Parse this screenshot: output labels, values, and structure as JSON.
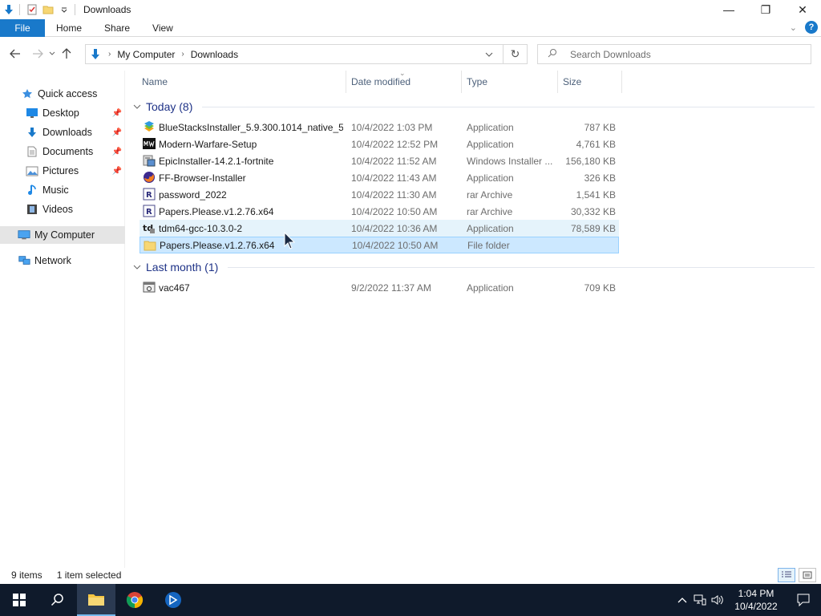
{
  "window": {
    "title": "Downloads",
    "controls": {
      "minimize": "—",
      "maximize": "❐",
      "close": "✕"
    }
  },
  "ribbon": {
    "tabs": [
      "File",
      "Home",
      "Share",
      "View"
    ]
  },
  "address": {
    "crumbs": [
      "My Computer",
      "Downloads"
    ]
  },
  "search": {
    "placeholder": "Search Downloads"
  },
  "nav": {
    "quick_access": "Quick access",
    "items": [
      {
        "label": "Desktop",
        "icon": "desktop-icon",
        "pinned": true
      },
      {
        "label": "Downloads",
        "icon": "downloads-icon",
        "pinned": true
      },
      {
        "label": "Documents",
        "icon": "documents-icon",
        "pinned": true
      },
      {
        "label": "Pictures",
        "icon": "pictures-icon",
        "pinned": true
      },
      {
        "label": "Music",
        "icon": "music-icon",
        "pinned": false
      },
      {
        "label": "Videos",
        "icon": "videos-icon",
        "pinned": false
      }
    ],
    "my_computer": "My Computer",
    "network": "Network"
  },
  "columns": {
    "name": "Name",
    "date": "Date modified",
    "type": "Type",
    "size": "Size"
  },
  "groups": [
    {
      "label": "Today (8)",
      "files": [
        {
          "name": "BlueStacksInstaller_5.9.300.1014_native_5...",
          "date": "10/4/2022 1:03 PM",
          "type": "Application",
          "size": "787 KB",
          "icon": "bluestacks-icon"
        },
        {
          "name": "Modern-Warfare-Setup",
          "date": "10/4/2022 12:52 PM",
          "type": "Application",
          "size": "4,761 KB",
          "icon": "modern-warfare-icon"
        },
        {
          "name": "EpicInstaller-14.2.1-fortnite",
          "date": "10/4/2022 11:52 AM",
          "type": "Windows Installer ...",
          "size": "156,180 KB",
          "icon": "installer-icon"
        },
        {
          "name": "FF-Browser-Installer",
          "date": "10/4/2022 11:43 AM",
          "type": "Application",
          "size": "326 KB",
          "icon": "firefox-icon"
        },
        {
          "name": "password_2022",
          "date": "10/4/2022 11:30 AM",
          "type": "rar Archive",
          "size": "1,541 KB",
          "icon": "rar-icon"
        },
        {
          "name": "Papers.Please.v1.2.76.x64",
          "date": "10/4/2022 10:50 AM",
          "type": "rar Archive",
          "size": "30,332 KB",
          "icon": "rar-icon"
        },
        {
          "name": "tdm64-gcc-10.3.0-2",
          "date": "10/4/2022 10:36 AM",
          "type": "Application",
          "size": "78,589 KB",
          "icon": "tdm-icon"
        },
        {
          "name": "Papers.Please.v1.2.76.x64",
          "date": "10/4/2022 10:50 AM",
          "type": "File folder",
          "size": "",
          "icon": "folder-icon"
        }
      ]
    },
    {
      "label": "Last month (1)",
      "files": [
        {
          "name": "vac467",
          "date": "9/2/2022 11:37 AM",
          "type": "Application",
          "size": "709 KB",
          "icon": "app-icon"
        }
      ]
    }
  ],
  "status": {
    "items": "9 items",
    "selected": "1 item selected"
  },
  "taskbar": {
    "time": "1:04 PM",
    "date": "10/4/2022"
  },
  "colors": {
    "accent": "#1979ca",
    "selection": "#cce8ff",
    "hover": "#e5f3fb",
    "group_text": "#1e3287",
    "taskbar": "#0f1a2b"
  }
}
